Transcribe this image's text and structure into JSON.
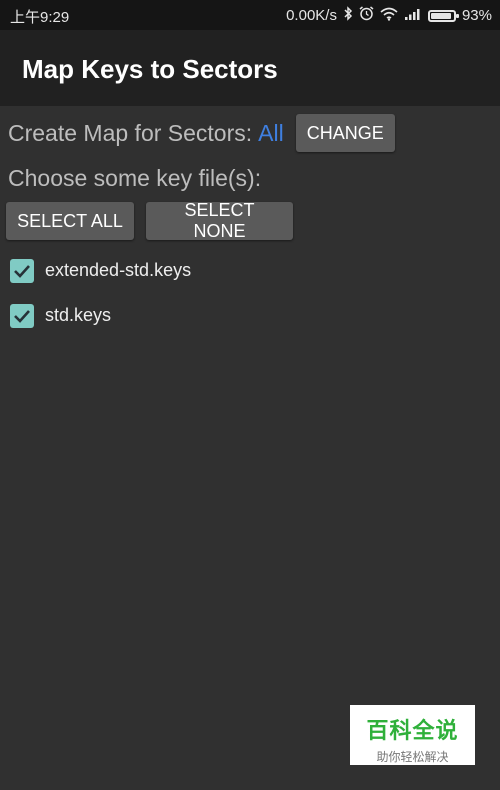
{
  "status_bar": {
    "time": "上午9:29",
    "network_speed": "0.00K/s",
    "battery": "93%",
    "battery_level": 0.93,
    "icons": [
      "bluetooth-icon",
      "alarm-icon",
      "wifi-icon",
      "signal-icon",
      "battery-icon"
    ]
  },
  "app_bar": {
    "title": "Map Keys to Sectors"
  },
  "sectors": {
    "label": "Create Map for Sectors:",
    "value": "All",
    "value_color": "#3f7fe0",
    "change_label": "CHANGE"
  },
  "keys": {
    "prompt": "Choose some key file(s):",
    "select_all_label": "SELECT ALL",
    "select_none_label": "SELECT NONE",
    "files": [
      {
        "name": "extended-std.keys",
        "checked": true
      },
      {
        "name": "std.keys",
        "checked": true
      }
    ],
    "checkbox_color": "#80cbc4"
  },
  "watermark": {
    "main": "百科全说",
    "sub": "助你轻松解决"
  }
}
